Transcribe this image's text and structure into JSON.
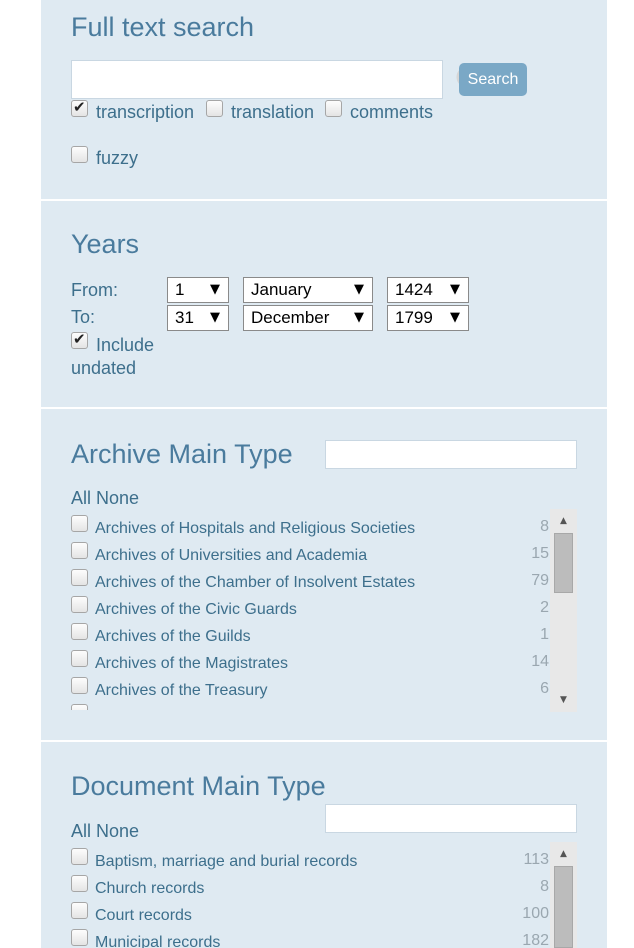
{
  "fulltext": {
    "title": "Full text search",
    "query_value": "",
    "search_label": "Search",
    "options": [
      {
        "label": "transcription",
        "checked": true
      },
      {
        "label": "translation",
        "checked": false
      },
      {
        "label": "comments",
        "checked": false
      },
      {
        "label": "fuzzy",
        "checked": false
      }
    ]
  },
  "years": {
    "title": "Years",
    "from_label": "From:",
    "to_label": "To:",
    "from": {
      "day": "1",
      "month": "January",
      "year": "1424"
    },
    "to": {
      "day": "31",
      "month": "December",
      "year": "1799"
    },
    "include_undated_line1": "Include",
    "include_undated_line2": "undated",
    "include_undated_checked": true
  },
  "archive_type": {
    "title": "Archive Main Type",
    "filter_value": "",
    "all_label": "All",
    "none_label": "None",
    "items": [
      {
        "name": "Archives of Hospitals and Religious Societies",
        "count": "8"
      },
      {
        "name": "Archives of Universities and Academia",
        "count": "15"
      },
      {
        "name": "Archives of the Chamber of Insolvent Estates",
        "count": "79"
      },
      {
        "name": "Archives of the Civic Guards",
        "count": "2"
      },
      {
        "name": "Archives of the Guilds",
        "count": "1"
      },
      {
        "name": "Archives of the Magistrates",
        "count": "14"
      },
      {
        "name": "Archives of the Treasury",
        "count": "6"
      }
    ]
  },
  "document_type": {
    "title": "Document Main Type",
    "filter_value": "",
    "all_label": "All",
    "none_label": "None",
    "items": [
      {
        "name": "Baptism, marriage and burial records",
        "count": "113"
      },
      {
        "name": "Church records",
        "count": "8"
      },
      {
        "name": "Court records",
        "count": "100"
      },
      {
        "name": "Municipal records",
        "count": "182"
      }
    ]
  },
  "colors": {
    "panel_bg": "#dfeaf2",
    "heading": "#4a7b9d",
    "button": "#7aa8c6"
  }
}
